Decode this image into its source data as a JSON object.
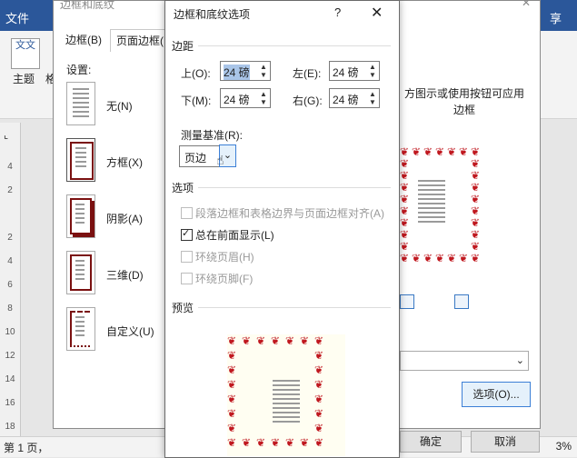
{
  "word": {
    "file_tab": "文件",
    "share_tab": "享",
    "theme_icon_text": "文文",
    "theme_label": "主题",
    "theme_sub": "格",
    "status_page": "第 1 页，",
    "status_zoom": "3%",
    "ruler_numbers": [
      "4",
      "2",
      "",
      "2",
      "4",
      "6",
      "8",
      "10",
      "12",
      "14",
      "16",
      "18"
    ]
  },
  "bg_dialog": {
    "title": "边框和底纹",
    "tabs": [
      "边框(B)",
      "页面边框(P)"
    ],
    "settings_label": "设置:",
    "presets": [
      "无(N)",
      "方框(X)",
      "阴影(A)",
      "三维(D)",
      "自定义(U)"
    ],
    "hint": "方图示或使用按钮可应用边框",
    "options_button": "选项(O)...",
    "ok_button": "确定",
    "cancel_button": "取消"
  },
  "fg_dialog": {
    "title": "边框和底纹选项",
    "help": "?",
    "close": "✕",
    "margins_label": "边距",
    "top_label": "上(O):",
    "top_value": "24 磅",
    "left_label": "左(E):",
    "left_value": "24 磅",
    "bottom_label": "下(M):",
    "bottom_value": "24 磅",
    "right_label": "右(G):",
    "right_value": "24 磅",
    "measure_label": "测量基准(R):",
    "measure_value": "页边",
    "options_label": "选项",
    "opt_align": "段落边框和表格边界与页面边框对齐(A)",
    "opt_front": "总在前面显示(L)",
    "opt_header": "环绕页眉(H)",
    "opt_footer": "环绕页脚(F)",
    "preview_label": "预览",
    "opt_align_checked": false,
    "opt_front_checked": true,
    "opt_header_checked": false,
    "opt_footer_checked": false
  },
  "colors": {
    "ribbon": "#2b579a",
    "border_art": "#c0181f",
    "accent": "#3c7fd6"
  }
}
